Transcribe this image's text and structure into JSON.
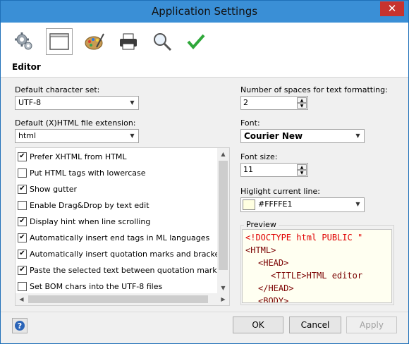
{
  "window": {
    "title": "Application Settings",
    "close_glyph": "✕"
  },
  "toolbar": {
    "buttons": [
      {
        "icon": "gear-icon"
      },
      {
        "icon": "window-icon",
        "active": true
      },
      {
        "icon": "palette-icon"
      },
      {
        "icon": "printer-icon"
      },
      {
        "icon": "magnifier-icon"
      },
      {
        "icon": "checkmark-icon"
      }
    ]
  },
  "section": {
    "title": "Editor"
  },
  "left": {
    "charset_label": "Default character set:",
    "charset_value": "UTF-8",
    "extension_label": "Default (X)HTML file extension:",
    "extension_value": "html",
    "options": [
      {
        "label": "Prefer XHTML from HTML",
        "checked": true
      },
      {
        "label": "Put HTML tags with lowercase",
        "checked": false
      },
      {
        "label": "Show gutter",
        "checked": true
      },
      {
        "label": "Enable Drag&Drop by text edit",
        "checked": false
      },
      {
        "label": "Display hint when line scrolling",
        "checked": true
      },
      {
        "label": "Automatically insert end tags in ML languages",
        "checked": true
      },
      {
        "label": "Automatically insert quotation marks and brackets terminal",
        "checked": true
      },
      {
        "label": "Paste the selected text between quotation marks and brackets",
        "checked": true
      },
      {
        "label": "Set BOM chars into the UTF-8 files",
        "checked": false
      }
    ]
  },
  "right": {
    "spaces_label": "Number of spaces for text formatting:",
    "spaces_value": "2",
    "font_label": "Font:",
    "font_value": "Courier New",
    "fontsize_label": "Font size:",
    "fontsize_value": "11",
    "highlight_label": "Higlight current line:",
    "highlight_value": "#FFFFE1",
    "highlight_color": "#FFFFE1",
    "preview_label": "Preview",
    "preview_lines": [
      "<!DOCTYPE html PUBLIC \"",
      "<HTML>",
      "<HEAD>",
      "<TITLE>HTML editor",
      "</HEAD>",
      "<BODY>"
    ]
  },
  "footer": {
    "ok": "OK",
    "cancel": "Cancel",
    "apply": "Apply"
  },
  "colors": {
    "titlebar": "#3a8fd6",
    "close": "#c7332e",
    "tag": "#7a0000",
    "doctype": "#e00000"
  }
}
